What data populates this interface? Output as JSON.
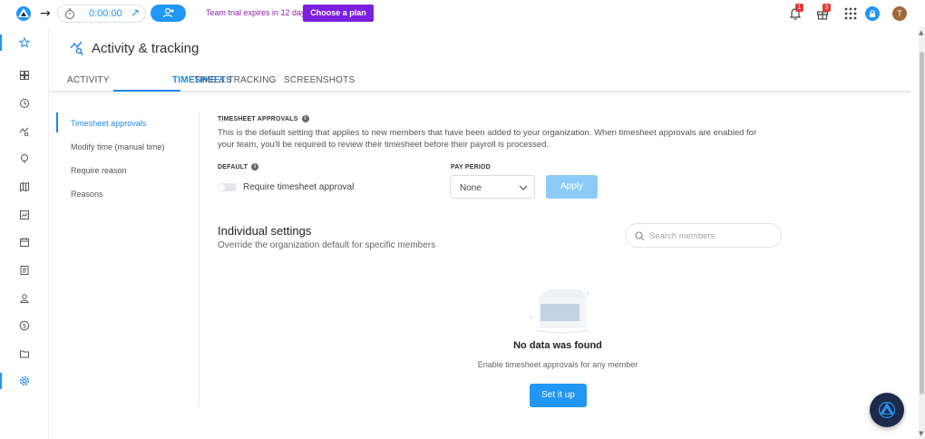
{
  "topbar": {
    "timer": "0:00:00",
    "trial_text": "Team trial expires in 12 days.",
    "choose_plan": "Choose a plan",
    "notifications_count": "1",
    "gifts_count": "3",
    "avatar_initial": "T"
  },
  "page": {
    "title": "Activity & tracking"
  },
  "tabs": [
    {
      "label": "ACTIVITY"
    },
    {
      "label": "TIMESHEETS"
    },
    {
      "label": "TIME & TRACKING"
    },
    {
      "label": "SCREENSHOTS"
    }
  ],
  "settings_nav": [
    {
      "label": "Timesheet approvals"
    },
    {
      "label": "Modify time (manual time)"
    },
    {
      "label": "Require reason"
    },
    {
      "label": "Reasons"
    }
  ],
  "main": {
    "section_label": "TIMESHEET APPROVALS",
    "description": "This is the default setting that applies to new members that have been added to your organization. When timesheet approvals are enabled for your team, you'll be required to review their timesheet before their payroll is processed.",
    "default_label": "DEFAULT",
    "toggle_label": "Require timesheet approval",
    "pay_period_label": "PAY PERIOD",
    "pay_period_value": "None",
    "apply_label": "Apply",
    "individual_title": "Individual settings",
    "individual_subtitle": "Override the organization default for specific members",
    "search_placeholder": "Search members",
    "empty_title": "No data was found",
    "empty_subtitle": "Enable timesheet approvals for any member",
    "setup_label": "Set it up"
  },
  "icons": {
    "sidebar": [
      "star-icon",
      "dashboard-icon",
      "clock-icon",
      "activity-icon",
      "location-icon",
      "map-icon",
      "reports-icon",
      "calendar-icon",
      "timesheet-icon",
      "people-icon",
      "dollar-icon",
      "projects-icon",
      "settings-icon"
    ]
  },
  "colors": {
    "accent": "#2196f3",
    "plan_button": "#7b1fe0",
    "trial_text": "#8e24aa",
    "badge": "#e53935"
  }
}
